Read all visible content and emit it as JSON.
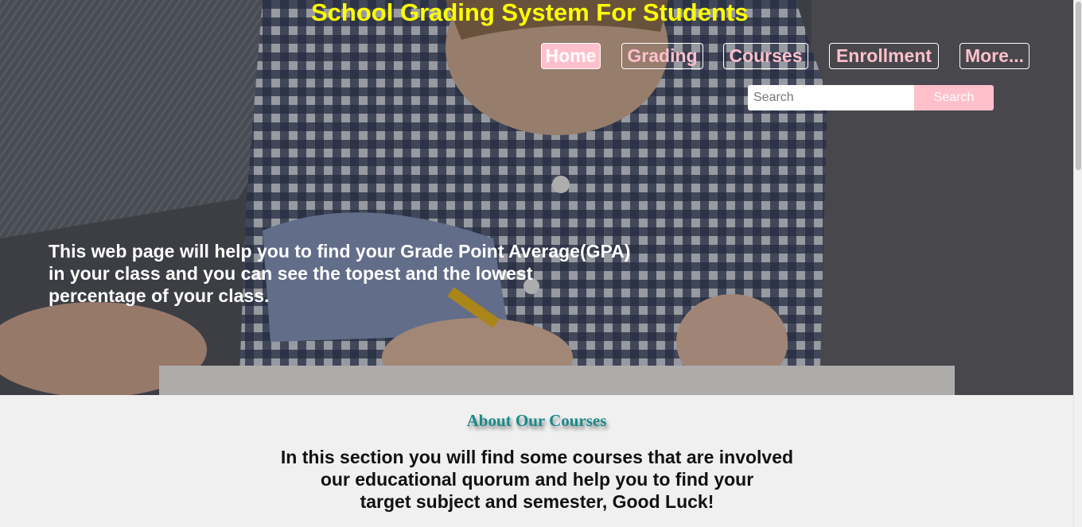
{
  "header": {
    "title": "School Grading System For Students"
  },
  "nav": {
    "items": [
      {
        "label": "Home",
        "active": true
      },
      {
        "label": "Grading",
        "active": false
      },
      {
        "label": "Courses",
        "active": false
      },
      {
        "label": "Enrollment",
        "active": false
      },
      {
        "label": "More...",
        "active": false
      }
    ]
  },
  "search": {
    "placeholder": "Search",
    "value": "",
    "button_label": "Search"
  },
  "hero": {
    "lines": [
      "This web page will help you to find your Grade Point Average(GPA)",
      "in your class and you can see the topest and the lowest",
      "percentage of your class."
    ]
  },
  "about": {
    "heading": "About Our Courses",
    "lines": [
      "In this section you will find some courses that are involved",
      "our educational quorum and help you to find your",
      "target subject and semester, Good Luck!"
    ]
  },
  "colors": {
    "title": "#ffff00",
    "nav_text": "#ffc0cb",
    "accent_pink": "#ffc0cb",
    "about_heading": "#1a8a8a"
  }
}
